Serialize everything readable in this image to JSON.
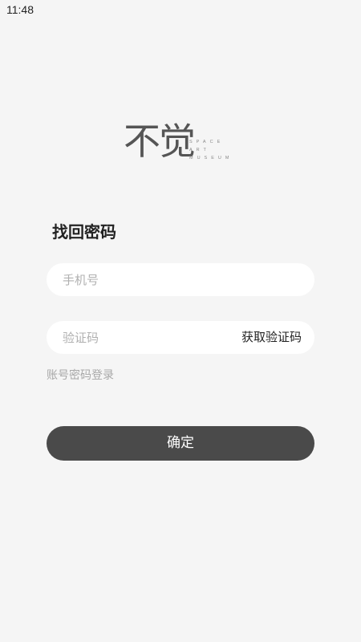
{
  "status_bar": {
    "time": "11:48"
  },
  "logo": {
    "mark": "不觉",
    "sub_line_1": "SPACE",
    "sub_line_2": "ART",
    "sub_line_3": "MUSEUM"
  },
  "page": {
    "title": "找回密码"
  },
  "form": {
    "phone": {
      "placeholder": "手机号",
      "value": ""
    },
    "code": {
      "placeholder": "验证码",
      "value": "",
      "get_code_label": "获取验证码"
    },
    "account_login_label": "账号密码登录",
    "confirm_label": "确定"
  },
  "colors": {
    "background": "#f5f5f5",
    "field_background": "#ffffff",
    "button_background": "#4a4a4a",
    "button_text": "#ffffff",
    "muted_text": "#a8a8a8"
  }
}
